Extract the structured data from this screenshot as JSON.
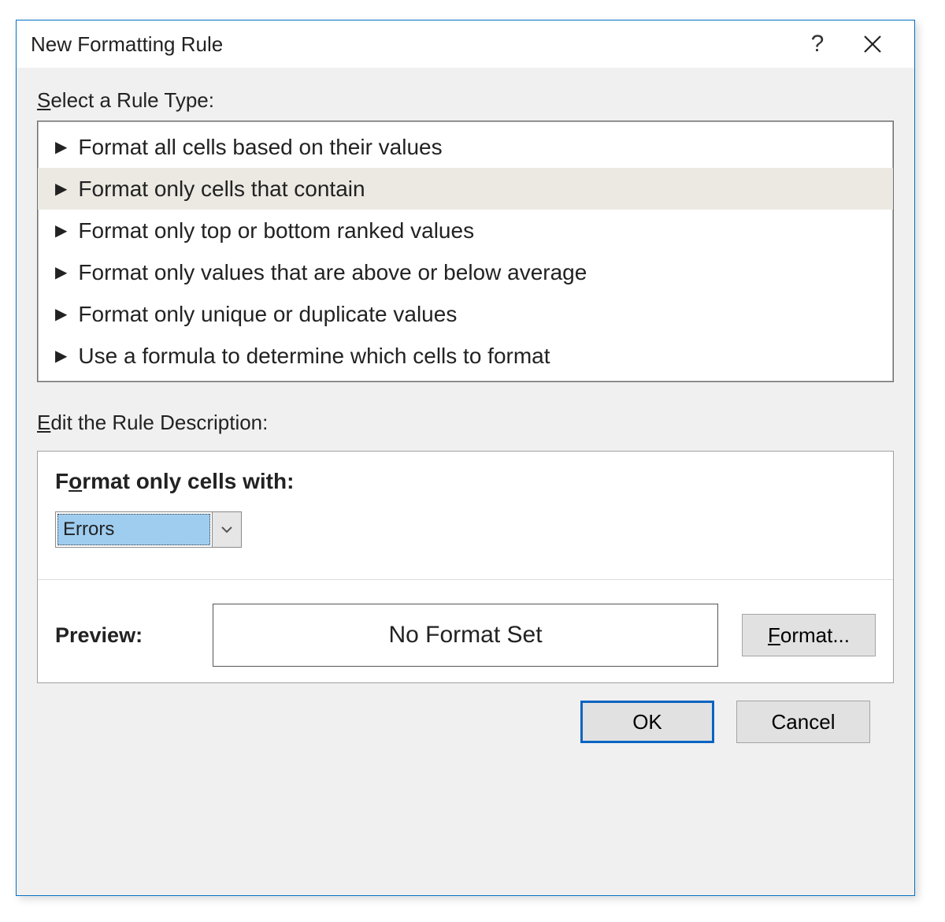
{
  "dialog": {
    "title": "New Formatting Rule",
    "help_tooltip": "?",
    "close_tooltip": "×"
  },
  "section_select_label": "Select a Rule Type:",
  "rule_types": [
    "Format all cells based on their values",
    "Format only cells that contain",
    "Format only top or bottom ranked values",
    "Format only values that are above or below average",
    "Format only unique or duplicate values",
    "Use a formula to determine which cells to format"
  ],
  "selected_rule_index": 1,
  "section_edit_label": "Edit the Rule Description:",
  "panel": {
    "heading": "Format only cells with:",
    "dropdown_value": "Errors",
    "preview_label": "Preview:",
    "preview_text": "No Format Set",
    "format_button": "Format..."
  },
  "footer": {
    "ok": "OK",
    "cancel": "Cancel"
  }
}
